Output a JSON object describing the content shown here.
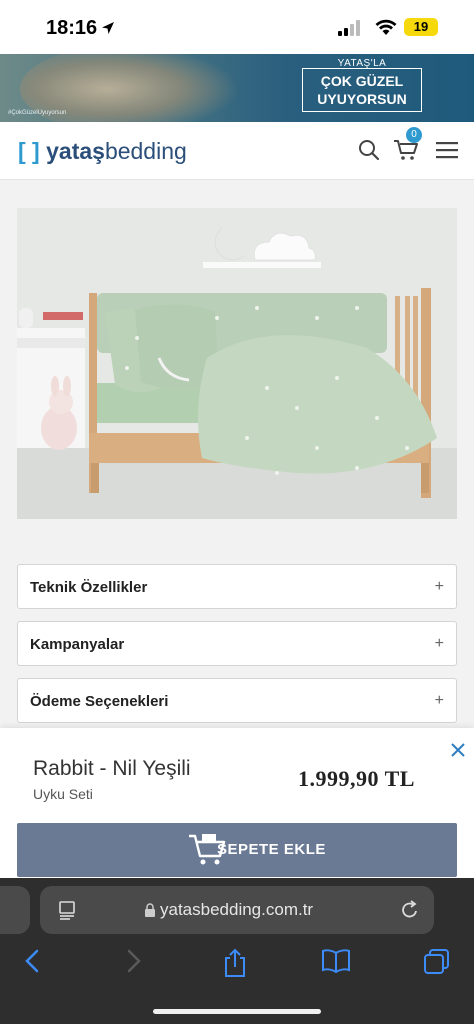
{
  "status_bar": {
    "time": "18:16",
    "battery": "19"
  },
  "banner": {
    "hashtag": "#ÇokGüzelUyuyorsun",
    "subtitle": "YATAŞ'LA",
    "headline_line1": "ÇOK GÜZEL",
    "headline_line2": "UYUYORSUN"
  },
  "header": {
    "logo_bold": "yataş",
    "logo_light": "bedding",
    "cart_count": "0"
  },
  "accordions": [
    {
      "label": "Teknik Özellikler",
      "icon": "+"
    },
    {
      "label": "Kampanyalar",
      "icon": "+"
    },
    {
      "label": "Ödeme Seçenekleri",
      "icon": "+"
    }
  ],
  "product": {
    "name": "Rabbit - Nil Yeşili",
    "subtitle": "Uyku Seti",
    "price": "1.999,90 TL",
    "add_to_cart": "SEPETE EKLE"
  },
  "browser": {
    "url": "yatasbedding.com.tr"
  },
  "colors": {
    "brand_blue": "#2b4f7a",
    "accent_blue": "#2f9ad0",
    "cta_button": "#6a7a95",
    "safari_toolbar": "#2e2e2e",
    "safari_icon_blue": "#3d8bf7"
  }
}
